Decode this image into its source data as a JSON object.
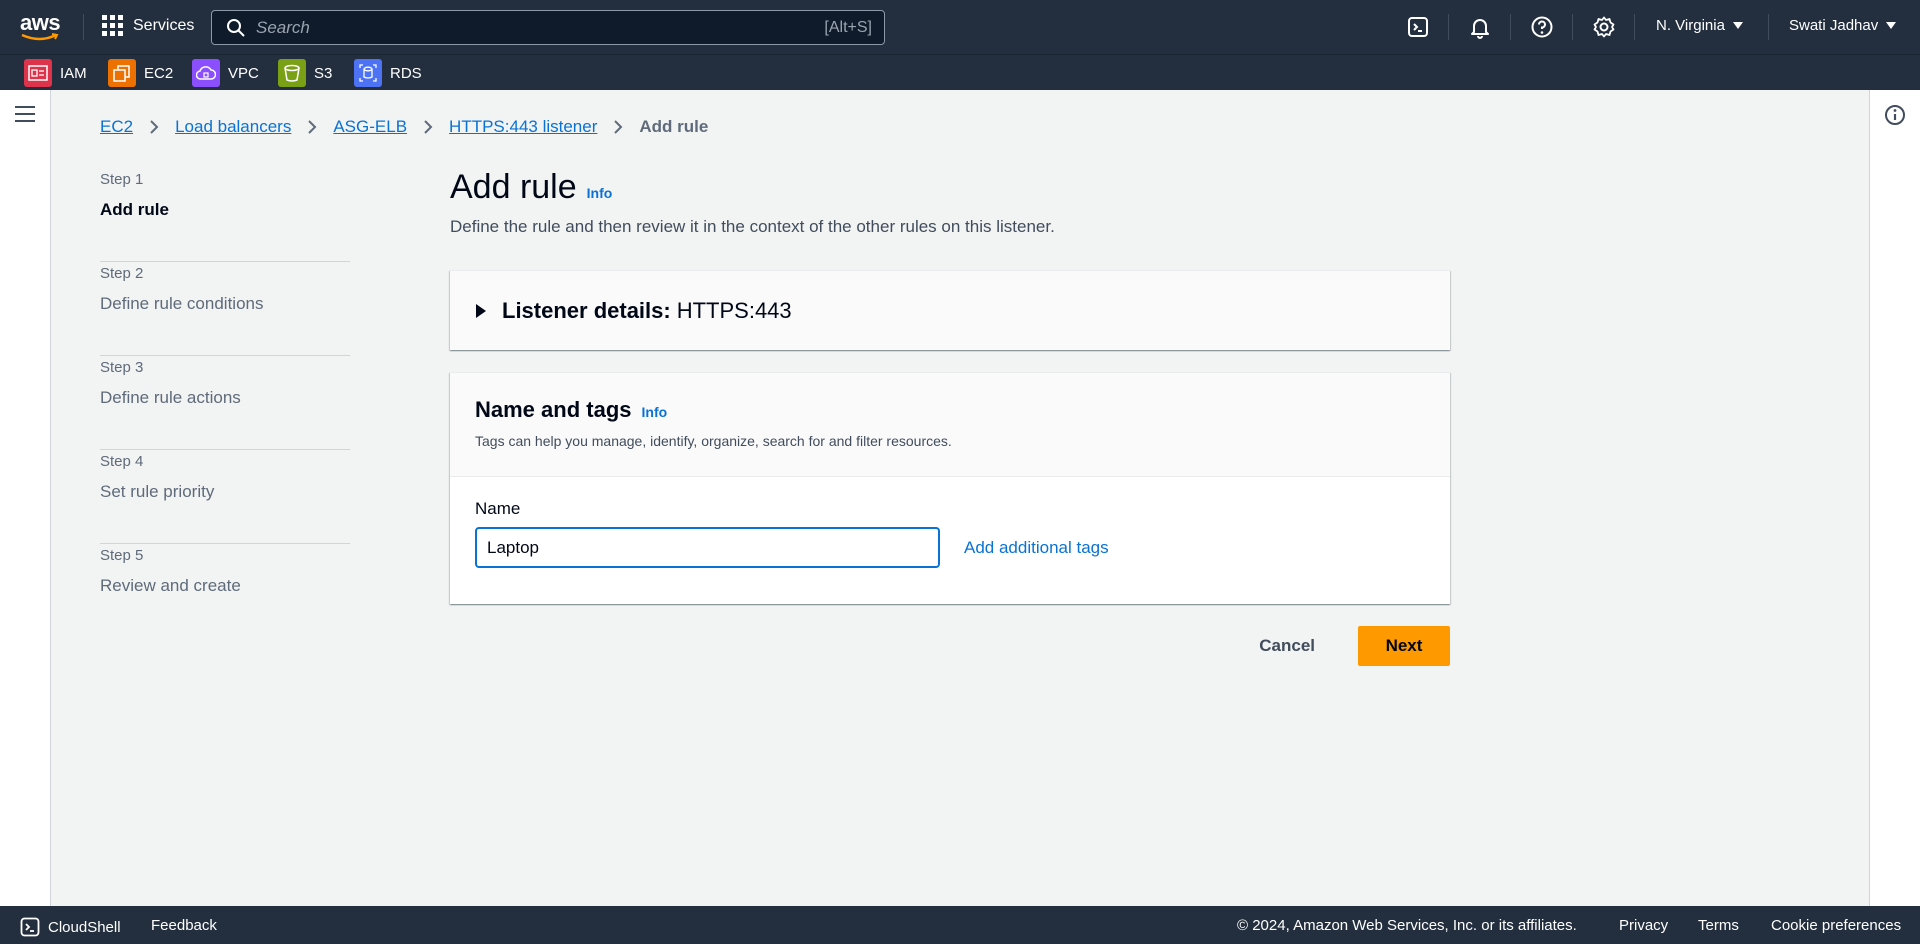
{
  "topbar": {
    "logo_text": "aws",
    "services_label": "Services",
    "search_placeholder": "Search",
    "search_shortcut": "[Alt+S]",
    "region": "N. Virginia",
    "user": "Swati Jadhav",
    "icons": [
      "cloudshell-icon",
      "bell-icon",
      "help-icon",
      "gear-icon"
    ]
  },
  "favorites": [
    {
      "label": "IAM",
      "color": "#dd344c"
    },
    {
      "label": "EC2",
      "color": "#ed7100"
    },
    {
      "label": "VPC",
      "color": "#8c4fff"
    },
    {
      "label": "S3",
      "color": "#7aa116"
    },
    {
      "label": "RDS",
      "color": "#4d72f3"
    }
  ],
  "breadcrumb": {
    "items": [
      "EC2",
      "Load balancers",
      "ASG-ELB",
      "HTTPS:443 listener"
    ],
    "current": "Add rule"
  },
  "steps": [
    {
      "num": "Step 1",
      "label": "Add rule"
    },
    {
      "num": "Step 2",
      "label": "Define rule conditions"
    },
    {
      "num": "Step 3",
      "label": "Define rule actions"
    },
    {
      "num": "Step 4",
      "label": "Set rule priority"
    },
    {
      "num": "Step 5",
      "label": "Review and create"
    }
  ],
  "main": {
    "title": "Add rule",
    "info": "Info",
    "description": "Define the rule and then review it in the context of the other rules on this listener.",
    "listener_title": "Listener details:",
    "listener_value": "HTTPS:443",
    "tags_title": "Name and tags",
    "tags_info": "Info",
    "tags_desc": "Tags can help you manage, identify, organize, search for and filter resources.",
    "name_label": "Name",
    "name_value": "Laptop",
    "add_tags": "Add additional tags",
    "cancel": "Cancel",
    "next": "Next"
  },
  "footer": {
    "cloudshell": "CloudShell",
    "feedback": "Feedback",
    "copyright": "© 2024, Amazon Web Services, Inc. or its affiliates.",
    "privacy": "Privacy",
    "terms": "Terms",
    "cookies": "Cookie preferences"
  },
  "colors": {
    "nav_bg": "#232f3e",
    "link": "#0972d3",
    "primary_button": "#ff9900"
  }
}
